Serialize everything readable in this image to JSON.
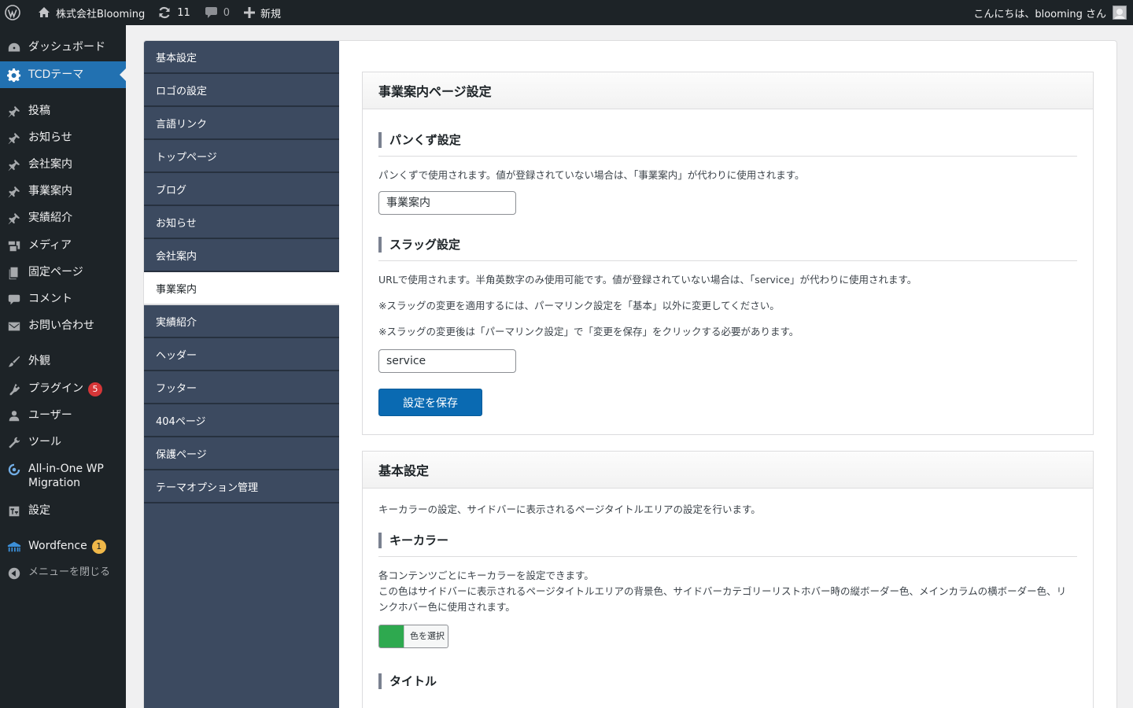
{
  "adminbar": {
    "site_name": "株式会社Blooming",
    "updates_count": "11",
    "comments_count": "0",
    "new_label": "新規",
    "greeting": "こんにちは、blooming さん"
  },
  "admin_menu": {
    "items": [
      {
        "label": "ダッシュボード",
        "icon": "dashboard-icon"
      },
      {
        "label": "TCDテーマ",
        "icon": "gear-icon"
      },
      {
        "label": "投稿",
        "icon": "pin-icon"
      },
      {
        "label": "お知らせ",
        "icon": "pin-icon"
      },
      {
        "label": "会社案内",
        "icon": "pin-icon"
      },
      {
        "label": "事業案内",
        "icon": "pin-icon"
      },
      {
        "label": "実績紹介",
        "icon": "pin-icon"
      },
      {
        "label": "メディア",
        "icon": "media-icon"
      },
      {
        "label": "固定ページ",
        "icon": "page-icon"
      },
      {
        "label": "コメント",
        "icon": "comment-icon"
      },
      {
        "label": "お問い合わせ",
        "icon": "mail-icon"
      },
      {
        "label": "外観",
        "icon": "brush-icon"
      },
      {
        "label": "プラグイン",
        "icon": "plugin-icon",
        "badge": "5"
      },
      {
        "label": "ユーザー",
        "icon": "user-icon"
      },
      {
        "label": "ツール",
        "icon": "wrench-icon"
      },
      {
        "label": "All-in-One WP",
        "label2": "Migration",
        "icon": "migration-icon"
      },
      {
        "label": "設定",
        "icon": "settings-icon"
      },
      {
        "label": "Wordfence",
        "icon": "wordfence-icon",
        "badge": "1"
      },
      {
        "label": "メニューを閉じる",
        "icon": "collapse-icon"
      }
    ]
  },
  "tcd_nav": {
    "items": [
      "基本設定",
      "ロゴの設定",
      "言語リンク",
      "トップページ",
      "ブログ",
      "お知らせ",
      "会社案内",
      "事業案内",
      "実績紹介",
      "ヘッダー",
      "フッター",
      "404ページ",
      "保護ページ",
      "テーマオプション管理"
    ],
    "active": "事業案内"
  },
  "service_panel": {
    "title": "事業案内ページ設定",
    "breadcrumb": {
      "title": "パンくず設定",
      "desc": "パンくずで使用されます。値が登録されていない場合は、「事業案内」が代わりに使用されます。",
      "value": "事業案内"
    },
    "slug": {
      "title": "スラッグ設定",
      "desc1": "URLで使用されます。半角英数字のみ使用可能です。値が登録されていない場合は、「service」が代わりに使用されます。",
      "desc2": "※スラッグの変更を適用するには、パーマリンク設定を「基本」以外に変更してください。",
      "desc3": "※スラッグの変更後は「パーマリンク設定」で「変更を保存」をクリックする必要があります。",
      "value": "service"
    },
    "save_label": "設定を保存"
  },
  "basic_panel": {
    "title": "基本設定",
    "desc": "キーカラーの設定、サイドバーに表示されるページタイトルエリアの設定を行います。",
    "keycolor": {
      "title": "キーカラー",
      "desc1": "各コンテンツごとにキーカラーを設定できます。",
      "desc2": "この色はサイドバーに表示されるページタイトルエリアの背景色、サイドバーカテゴリーリストホバー時の縦ボーダー色、メインカラムの横ボーダー色、リンクホバー色に使用されます。",
      "color": "#2ea94f",
      "button_label": "色を選択"
    },
    "title_section": {
      "title": "タイトル"
    }
  }
}
